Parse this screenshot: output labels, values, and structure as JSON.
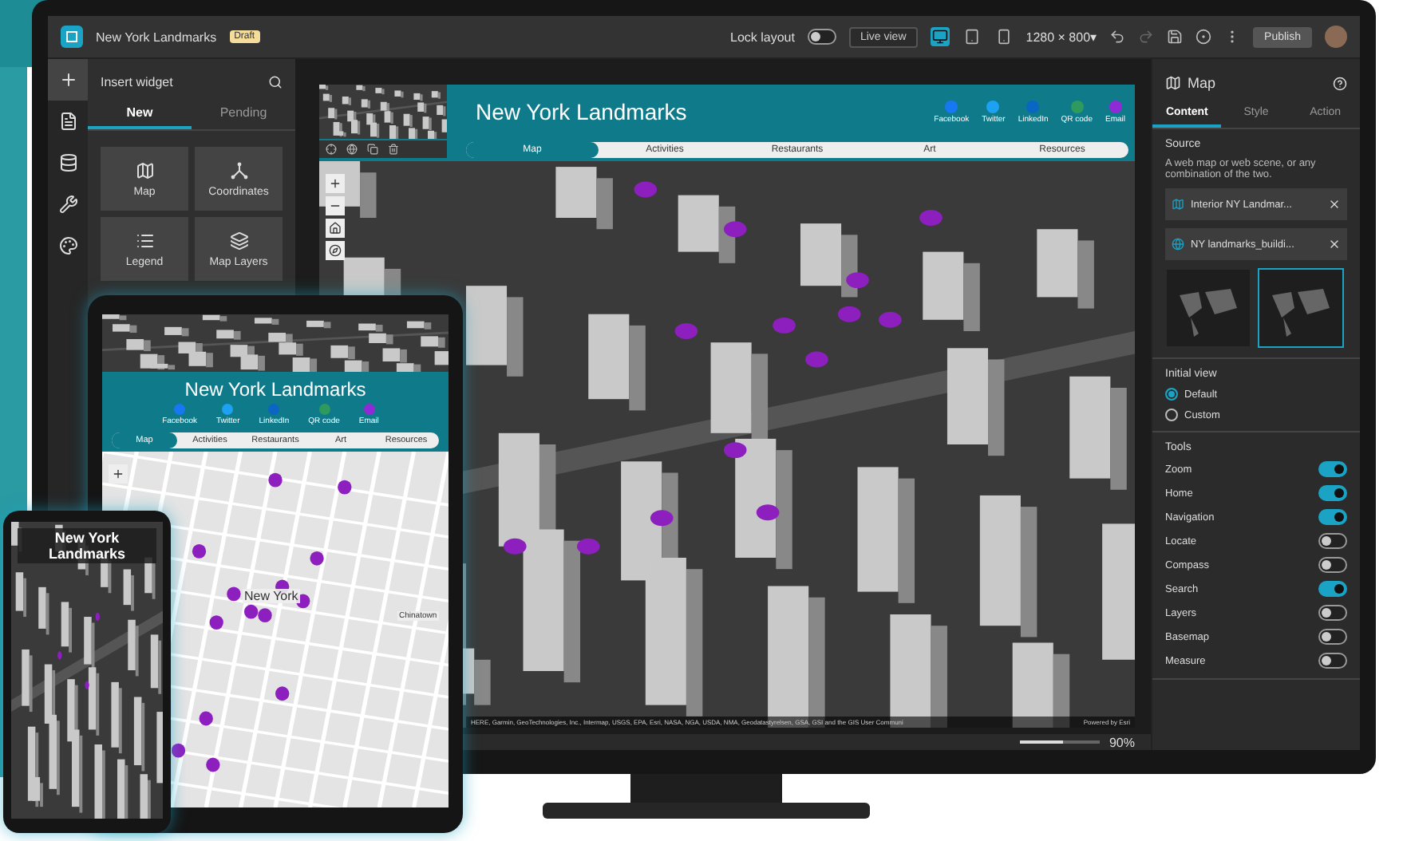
{
  "app": {
    "title": "New York Landmarks",
    "badge": "Draft",
    "lock_layout": {
      "label": "Lock layout",
      "on": false
    },
    "live_view": "Live view",
    "devices": [
      {
        "kind": "desktop",
        "selected": true
      },
      {
        "kind": "tablet",
        "selected": false
      },
      {
        "kind": "phone",
        "selected": false
      }
    ],
    "resolution": "1280 × 800▾",
    "publish": "Publish"
  },
  "rail": [
    {
      "kind": "add",
      "selected": true
    },
    {
      "kind": "page",
      "selected": false
    },
    {
      "kind": "data",
      "selected": false
    },
    {
      "kind": "tools",
      "selected": false
    },
    {
      "kind": "theme",
      "selected": false
    }
  ],
  "widget_panel": {
    "title": "Insert widget",
    "tabs": [
      {
        "label": "New",
        "selected": true
      },
      {
        "label": "Pending",
        "selected": false
      }
    ],
    "widgets": [
      {
        "label": "Map",
        "kind": "map"
      },
      {
        "label": "Coordinates",
        "kind": "coordinates"
      },
      {
        "label": "Legend",
        "kind": "legend"
      },
      {
        "label": "Map Layers",
        "kind": "layers"
      }
    ]
  },
  "preview": {
    "title": "New York Landmarks",
    "share": [
      {
        "label": "Facebook",
        "color": "#1877f2"
      },
      {
        "label": "Twitter",
        "color": "#1da1f2"
      },
      {
        "label": "LinkedIn",
        "color": "#0a66c2"
      },
      {
        "label": "QR code",
        "color": "#2e9a5e"
      },
      {
        "label": "Email",
        "color": "#8e2bd6"
      }
    ],
    "nav": [
      {
        "label": "Map",
        "selected": true
      },
      {
        "label": "Activities",
        "selected": false
      },
      {
        "label": "Restaurants",
        "selected": false
      },
      {
        "label": "Art",
        "selected": false
      },
      {
        "label": "Resources",
        "selected": false
      }
    ],
    "attribution": "HERE, Garmin, GeoTechnologies, Inc., Intermap, USGS, EPA, Esri, NASA, NGA, USDA, NMA, Geodatastyrelsen, GSA, GSI and the GIS User Communi",
    "powered": "Powered by Esri"
  },
  "settings": {
    "title": "Map",
    "tabs": [
      {
        "label": "Content",
        "selected": true
      },
      {
        "label": "Style",
        "selected": false
      },
      {
        "label": "Action",
        "selected": false
      }
    ],
    "source_heading": "Source",
    "source_hint": "A web map or web scene, or any combination of the two.",
    "sources": [
      {
        "label": "Interior NY Landmar...",
        "kind": "map"
      },
      {
        "label": "NY landmarks_buildi...",
        "kind": "scene"
      }
    ],
    "thumbnails": [
      {
        "selected": false
      },
      {
        "selected": true
      }
    ],
    "initial_view": {
      "heading": "Initial view",
      "options": [
        {
          "label": "Default",
          "selected": true
        },
        {
          "label": "Custom",
          "selected": false
        }
      ]
    },
    "tools_heading": "Tools",
    "tools": [
      {
        "label": "Zoom",
        "on": true
      },
      {
        "label": "Home",
        "on": true
      },
      {
        "label": "Navigation",
        "on": true
      },
      {
        "label": "Locate",
        "on": false
      },
      {
        "label": "Compass",
        "on": false
      },
      {
        "label": "Search",
        "on": true
      },
      {
        "label": "Layers",
        "on": false
      },
      {
        "label": "Basemap",
        "on": false
      },
      {
        "label": "Measure",
        "on": false
      }
    ]
  },
  "status": {
    "zoom": "90%",
    "level": 0.55
  },
  "tablet": {
    "title": "New York Landmarks",
    "share": [
      {
        "label": "Facebook",
        "color": "#1877f2"
      },
      {
        "label": "Twitter",
        "color": "#1da1f2"
      },
      {
        "label": "LinkedIn",
        "color": "#0a66c2"
      },
      {
        "label": "QR code",
        "color": "#2e9a5e"
      },
      {
        "label": "Email",
        "color": "#8e2bd6"
      }
    ],
    "nav": [
      {
        "label": "Map",
        "selected": true
      },
      {
        "label": "Activities",
        "selected": false
      },
      {
        "label": "Restaurants",
        "selected": false
      },
      {
        "label": "Art",
        "selected": false
      },
      {
        "label": "Resources",
        "selected": false
      }
    ],
    "map_labels": [
      "New York",
      "Chinatown"
    ]
  },
  "phone": {
    "title": "New York Landmarks"
  }
}
